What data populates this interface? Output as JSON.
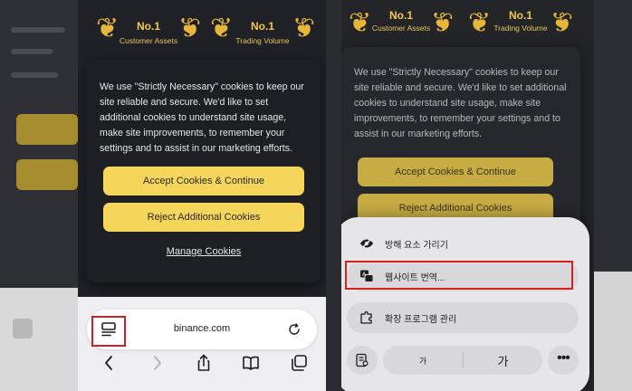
{
  "awards": [
    {
      "rank": "No.1",
      "label": "Customer Assets"
    },
    {
      "rank": "No.1",
      "label": "Trading Volume"
    }
  ],
  "cookie_banner": {
    "text": "We use \"Strictly Necessary\" cookies to keep our site reliable and secure. We'd like to set additional cookies to understand site usage, make site improvements, to remember your settings and to assist in our marketing efforts.",
    "accept_label": "Accept Cookies & Continue",
    "reject_label": "Reject Additional Cookies",
    "manage_label": "Manage Cookies"
  },
  "browser": {
    "url": "binance.com"
  },
  "page_menu": {
    "items": [
      {
        "icon": "eye-slash-icon",
        "label": "방해 요소 가리기"
      },
      {
        "icon": "translate-icon",
        "label": "웹사이트 번역..."
      },
      {
        "icon": "extensions-icon",
        "label": "확장 프로그램 관리"
      }
    ],
    "text_smaller": "가",
    "text_larger": "가"
  },
  "colors": {
    "accent_yellow": "#f5d55a",
    "highlight_red": "#d61f1f"
  }
}
